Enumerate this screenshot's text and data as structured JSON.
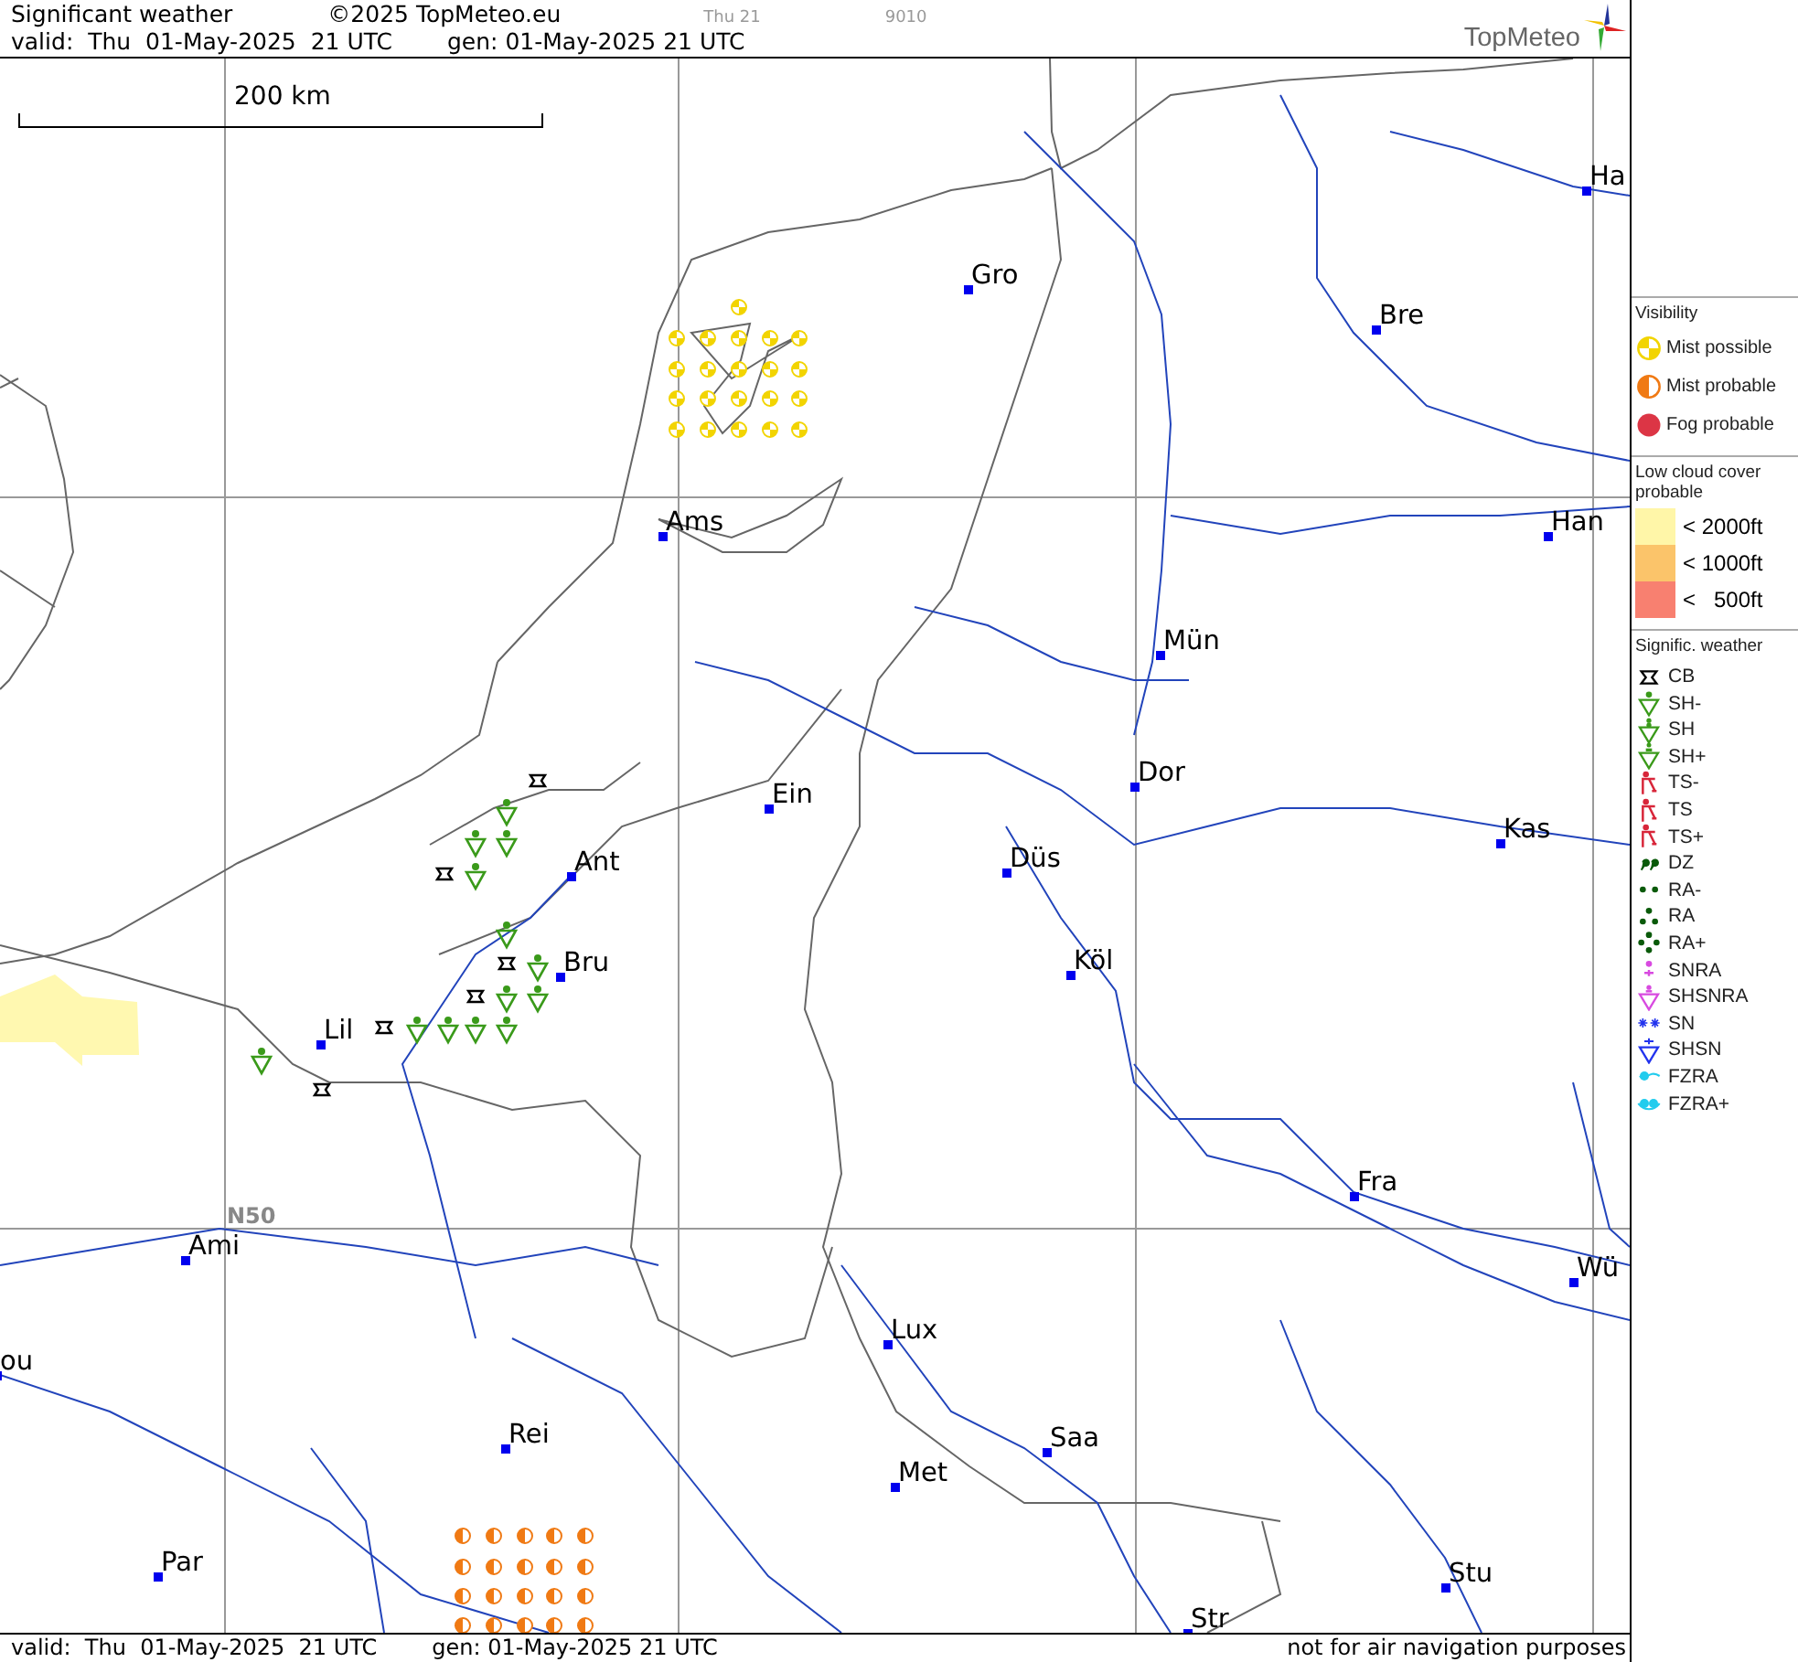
{
  "header": {
    "title": "Significant weather",
    "copyright": "©2025 TopMeteo.eu",
    "run_label": "Thu 21",
    "code": "9010",
    "valid": "valid:  Thu  01-May-2025  21 UTC",
    "generated": "gen: 01-May-2025 21 UTC",
    "logo": "TopMeteo"
  },
  "map": {
    "scale_label": "200 km",
    "grid_label": "N50",
    "cities": [
      {
        "name": "Ha"
      },
      {
        "name": "Gro"
      },
      {
        "name": "Bre"
      },
      {
        "name": "Ams"
      },
      {
        "name": "Han"
      },
      {
        "name": "Mün"
      },
      {
        "name": "Dor"
      },
      {
        "name": "Ein"
      },
      {
        "name": "Kas"
      },
      {
        "name": "Ant"
      },
      {
        "name": "Düs"
      },
      {
        "name": "Bru"
      },
      {
        "name": "Köl"
      },
      {
        "name": "Lil"
      },
      {
        "name": "Fra"
      },
      {
        "name": "Ami"
      },
      {
        "name": "Wü"
      },
      {
        "name": "ou"
      },
      {
        "name": "Lux"
      },
      {
        "name": "Rei"
      },
      {
        "name": "Saa"
      },
      {
        "name": "Met"
      },
      {
        "name": "Par"
      },
      {
        "name": "Stu"
      },
      {
        "name": "Str"
      }
    ]
  },
  "legend": {
    "visibility_title": "Visibility",
    "visibility": [
      {
        "kind": "mist-possible",
        "label": "Mist possible"
      },
      {
        "kind": "mist-probable",
        "label": "Mist probable"
      },
      {
        "kind": "fog-probable",
        "label": "Fog probable"
      }
    ],
    "cloud_title": "Low cloud cover probable",
    "cloud_levels": [
      "< 2000ft",
      "< 1000ft",
      "<   500ft"
    ],
    "weather_title": "Signific. weather",
    "weather": [
      {
        "kind": "cb",
        "label": "CB"
      },
      {
        "kind": "sh-light",
        "label": "SH-"
      },
      {
        "kind": "sh",
        "label": "SH"
      },
      {
        "kind": "sh-heavy",
        "label": "SH+"
      },
      {
        "kind": "ts-light",
        "label": "TS-"
      },
      {
        "kind": "ts",
        "label": "TS"
      },
      {
        "kind": "ts-heavy",
        "label": "TS+"
      },
      {
        "kind": "dz",
        "label": "DZ"
      },
      {
        "kind": "ra-light",
        "label": "RA-"
      },
      {
        "kind": "ra",
        "label": "RA"
      },
      {
        "kind": "ra-heavy",
        "label": "RA+"
      },
      {
        "kind": "snra",
        "label": "SNRA"
      },
      {
        "kind": "shsnra",
        "label": "SHSNRA"
      },
      {
        "kind": "sn",
        "label": "SN"
      },
      {
        "kind": "shsn",
        "label": "SHSN"
      },
      {
        "kind": "fzra",
        "label": "FZRA"
      },
      {
        "kind": "fzra-heavy",
        "label": "FZRA+"
      }
    ]
  },
  "footer": {
    "valid": "valid:  Thu  01-May-2025  21 UTC",
    "generated": "gen: 01-May-2025 21 UTC",
    "disclaimer": "not for air navigation purposes"
  }
}
